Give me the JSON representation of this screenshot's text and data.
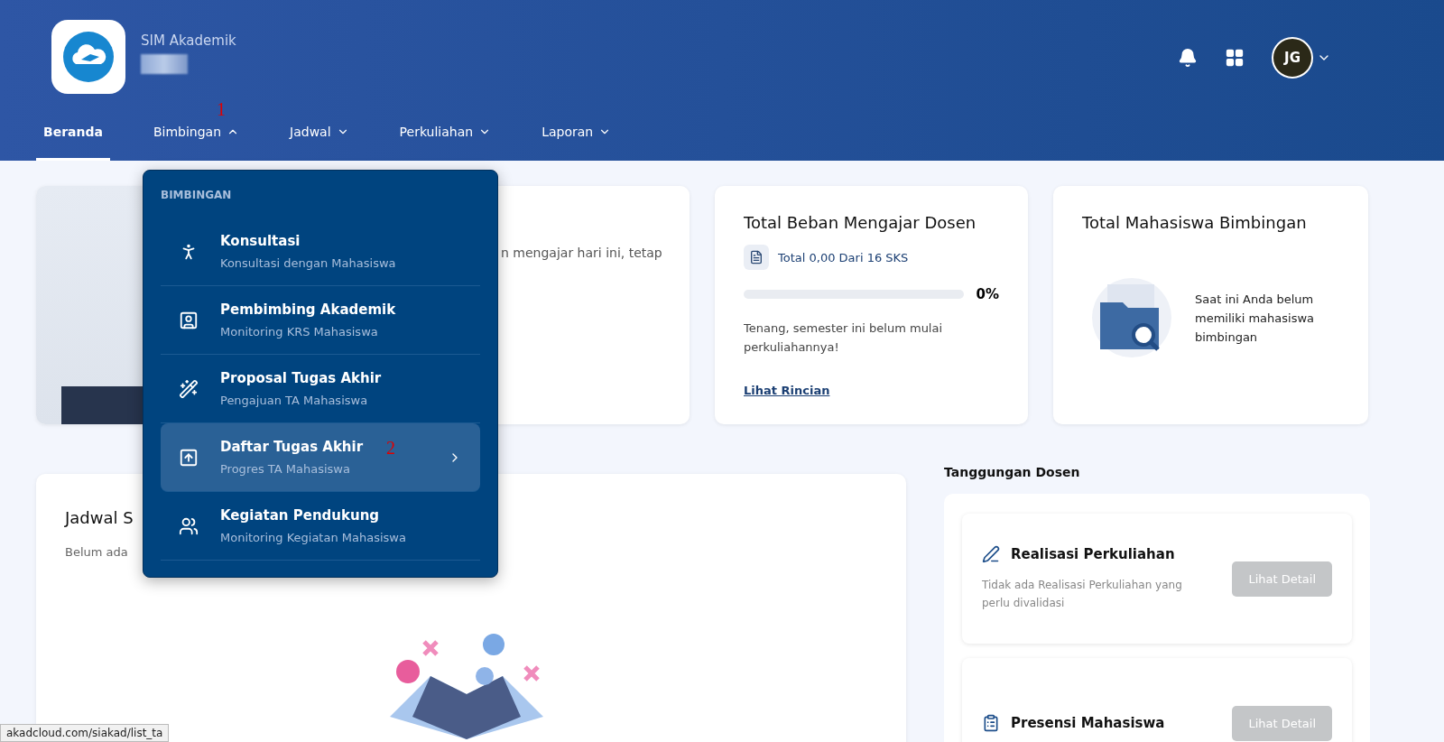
{
  "header": {
    "app_name": "SIM Akademik",
    "nav": [
      {
        "label": "Beranda",
        "kind": "link",
        "selected": true
      },
      {
        "label": "Bimbingan",
        "kind": "menu",
        "selected": false,
        "expanded": true
      },
      {
        "label": "Jadwal",
        "kind": "menu",
        "selected": false,
        "expanded": false
      },
      {
        "label": "Perkuliahan",
        "kind": "menu",
        "selected": false,
        "expanded": false
      },
      {
        "label": "Laporan",
        "kind": "menu",
        "selected": false,
        "expanded": false
      }
    ],
    "avatar": "JG"
  },
  "dropdown": {
    "heading": "BIMBINGAN",
    "items": [
      {
        "title": "Konsultasi",
        "subtitle": "Konsultasi dengan Mahasiswa",
        "selected": false
      },
      {
        "title": "Pembimbing Akademik",
        "subtitle": "Monitoring KRS Mahasiswa",
        "selected": false
      },
      {
        "title": "Proposal Tugas Akhir",
        "subtitle": "Pengajuan TA Mahasiswa",
        "selected": false
      },
      {
        "title": "Daftar Tugas Akhir",
        "subtitle": "Progres TA Mahasiswa",
        "selected": true
      },
      {
        "title": "Kegiatan Pendukung",
        "subtitle": "Monitoring Kegiatan Mahasiswa",
        "selected": false
      }
    ]
  },
  "annotations": [
    "1",
    "2"
  ],
  "welcome_card": {
    "text": "n mengajar hari ini, tetap"
  },
  "teaching_load": {
    "title": "Total Beban Mengajar Dosen",
    "summary": "Total 0,00 Dari 16 SKS",
    "level": 0,
    "reading": "0%",
    "message": "Tenang, semester ini belum mulai perkuliahannya!",
    "link": "Lihat Rincian"
  },
  "advisees": {
    "title": "Total Mahasiswa Bimbingan",
    "message": "Saat ini Anda belum memiliki mahasiswa bimbingan"
  },
  "schedule": {
    "title": "Jadwal S",
    "message": "Belum ada"
  },
  "duties": {
    "title": "Tanggungan Dosen",
    "items": [
      {
        "title": "Realisasi Perkuliahan",
        "kind": "realization",
        "message": "Tidak ada Realisasi Perkuliahan yang perlu divalidasi",
        "button": "Lihat Detail",
        "disabled": true
      },
      {
        "title": "Presensi Mahasiswa",
        "kind": "attendance",
        "button": "Lihat Detail",
        "disabled": true
      }
    ]
  },
  "status_bar": "akadcloud.com/siakad/list_ta"
}
